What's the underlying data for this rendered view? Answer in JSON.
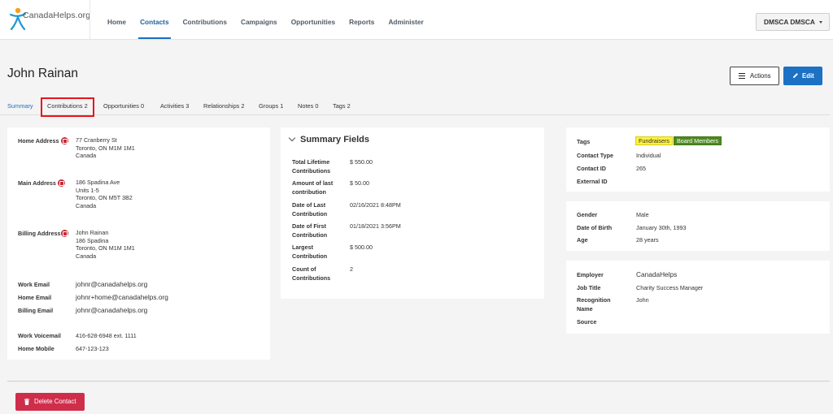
{
  "brand": {
    "logo_text": "CanadaHelps.org"
  },
  "nav": {
    "items": [
      {
        "label": "Home",
        "active": false
      },
      {
        "label": "Contacts",
        "active": true
      },
      {
        "label": "Contributions",
        "active": false
      },
      {
        "label": "Campaigns",
        "active": false
      },
      {
        "label": "Opportunities",
        "active": false
      },
      {
        "label": "Reports",
        "active": false
      },
      {
        "label": "Administer",
        "active": false
      }
    ],
    "user_label": "DMSCA DMSCA"
  },
  "contact": {
    "name": "John Rainan"
  },
  "header": {
    "actions_label": "Actions",
    "edit_label": "Edit"
  },
  "tabs": [
    {
      "label": "Summary",
      "active": true
    },
    {
      "label": "Contributions 2",
      "active": false,
      "highlighted": true
    },
    {
      "label": "Opportunities 0",
      "active": false
    },
    {
      "label": "Activities 3",
      "active": false
    },
    {
      "label": "Relationships 2",
      "active": false
    },
    {
      "label": "Groups 1",
      "active": false
    },
    {
      "label": "Notes 0",
      "active": false
    },
    {
      "label": "Tags 2",
      "active": false
    }
  ],
  "addresses": [
    {
      "label": "Home Address",
      "lines": [
        "77 Cranberry St",
        "Toronto, ON M1M 1M1",
        "Canada"
      ]
    },
    {
      "label": "Main Address",
      "lines": [
        "186 Spadina Ave",
        "Units 1-5",
        "Toronto, ON M5T 3B2",
        "Canada"
      ]
    },
    {
      "label": "Billing Address",
      "lines": [
        "John Rainan",
        "186 Spadina",
        "Toronto, ON M1M 1M1",
        "Canada"
      ]
    }
  ],
  "emails": [
    {
      "label": "Work Email",
      "value": "johnr@canadahelps.org"
    },
    {
      "label": "Home Email",
      "value": "johnr+home@canadahelps.org"
    },
    {
      "label": "Billing Email",
      "value": "johnr@canadahelps.org"
    }
  ],
  "phones": [
    {
      "label": "Work Voicemail",
      "value": "416-628-6948  ext. 1111"
    },
    {
      "label": "Home Mobile",
      "value": "647-123-123"
    }
  ],
  "summary_fields": {
    "title": "Summary Fields",
    "rows": [
      {
        "label_lines": [
          "Total Lifetime",
          "Contributions"
        ],
        "value": "$ 550.00"
      },
      {
        "label_lines": [
          "Amount of last",
          "contribution"
        ],
        "value": "$ 50.00"
      },
      {
        "label_lines": [
          "Date of Last",
          "Contribution"
        ],
        "value": "02/16/2021 8:48PM"
      },
      {
        "label_lines": [
          "Date of First",
          "Contribution"
        ],
        "value": "01/18/2021 3:56PM"
      },
      {
        "label_lines": [
          "Largest",
          "Contribution"
        ],
        "value": "$ 500.00"
      },
      {
        "label_lines": [
          "Count of",
          "Contributions"
        ],
        "value": "2"
      }
    ]
  },
  "tags_panel": {
    "tags_label": "Tags",
    "tags": [
      {
        "label": "Fundraisers",
        "color": "#fdf23c"
      },
      {
        "label": "Board Members",
        "color": "#4d8a1f"
      }
    ],
    "rows": [
      {
        "label": "Contact Type",
        "value": "Individual"
      },
      {
        "label": "Contact ID",
        "value": "265"
      },
      {
        "label": "External ID",
        "value": ""
      }
    ]
  },
  "demographics": [
    {
      "label": "Gender",
      "value": "Male"
    },
    {
      "label": "Date of Birth",
      "value": "January 30th, 1993"
    },
    {
      "label": "Age",
      "value": "28 years"
    }
  ],
  "employment": {
    "employer_label": "Employer",
    "employer_value": "CanadaHelps",
    "job_title_label": "Job Title",
    "job_title_value": "Charity Success Manager",
    "recognition_label_lines": [
      "Recognition",
      "Name"
    ],
    "recognition_value": "John",
    "source_label": "Source",
    "source_value": ""
  },
  "footer": {
    "delete_label": "Delete Contact"
  },
  "colors": {
    "primary": "#1c71c4",
    "danger": "#cf2e4b",
    "highlight": "#e8141a"
  }
}
